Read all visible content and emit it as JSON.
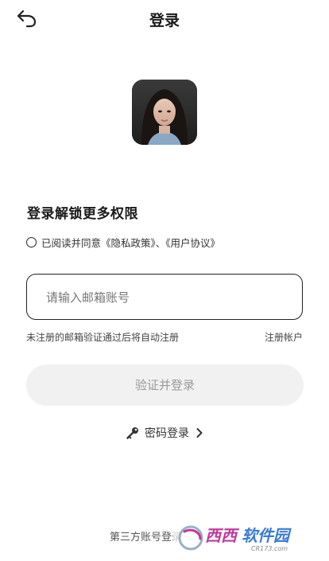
{
  "header": {
    "title": "登录",
    "back_icon": "back-arrow-icon"
  },
  "main": {
    "section_title": "登录解锁更多权限",
    "agreement_text": "已阅读并同意《隐私政策》、《用户协议》",
    "email_placeholder": "请输入邮箱账号",
    "hint_text": "未注册的邮箱验证通过后将自动注册",
    "register_link": "注册帐户",
    "login_button": "验证并登录",
    "password_login": "密码登录"
  },
  "footer": {
    "third_party_label": "第三方账号登录"
  },
  "watermark": {
    "text": "西西软件园",
    "sub_text": "CR173.com"
  },
  "colors": {
    "accent": "#222222",
    "button_bg": "#f1f1f1",
    "button_text": "#9a9a9a",
    "watermark": "#c0399a"
  }
}
